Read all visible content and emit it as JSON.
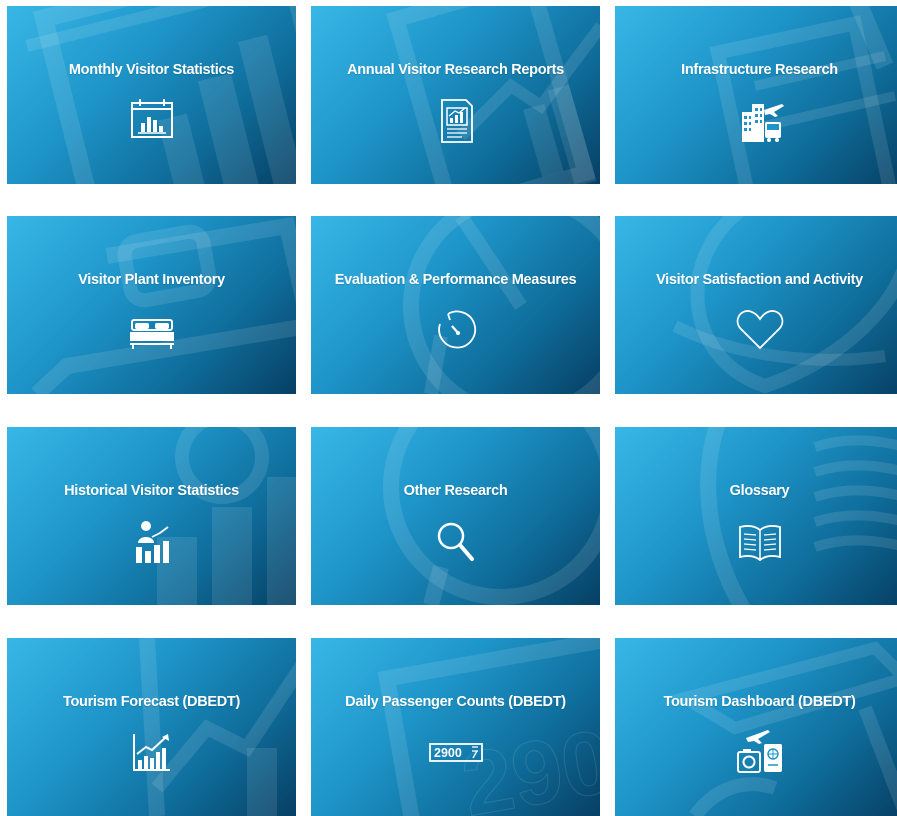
{
  "tiles": [
    {
      "label": "Monthly Visitor Statistics",
      "icon": "calendar-chart-icon"
    },
    {
      "label": "Annual Visitor Research Reports",
      "icon": "report-chart-icon"
    },
    {
      "label": "Infrastructure Research",
      "icon": "buildings-plane-bus-icon"
    },
    {
      "label": "Visitor Plant Inventory",
      "icon": "bed-icon"
    },
    {
      "label": "Evaluation & Performance Measures",
      "icon": "timer-icon"
    },
    {
      "label": "Visitor Satisfaction and Activity",
      "icon": "heart-icon"
    },
    {
      "label": "Historical Visitor Statistics",
      "icon": "presenter-chart-icon"
    },
    {
      "label": "Other Research",
      "icon": "magnifier-icon"
    },
    {
      "label": "Glossary",
      "icon": "open-book-icon"
    },
    {
      "label": "Tourism Forecast (DBEDT)",
      "icon": "trend-chart-icon"
    },
    {
      "label": "Daily Passenger Counts (DBEDT)",
      "icon": "counter-icon",
      "counter_text": "2900"
    },
    {
      "label": "Tourism Dashboard (DBEDT)",
      "icon": "travel-plane-passport-icon"
    }
  ],
  "colors": {
    "tile_light": "#38b7e6",
    "tile_mid": "#1e95c9",
    "tile_dark": "#063f63",
    "text": "#ffffff"
  }
}
